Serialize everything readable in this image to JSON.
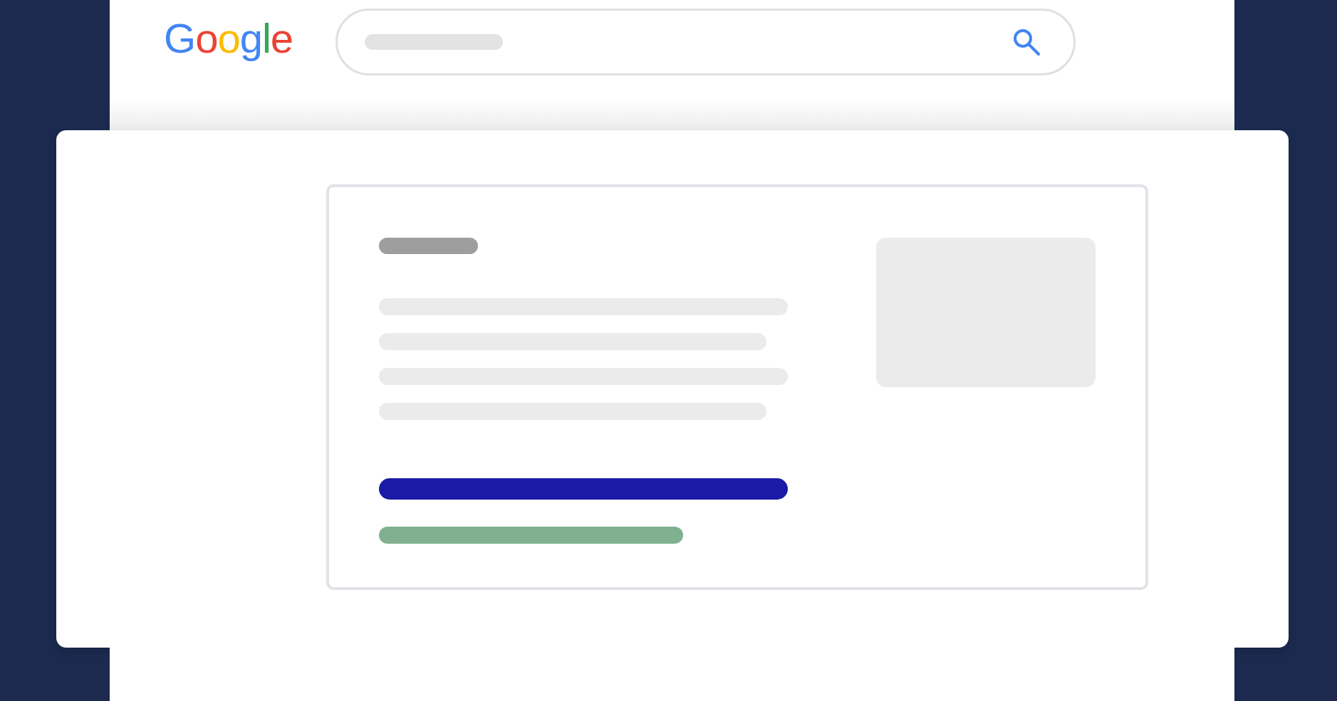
{
  "logo": {
    "text": "Google"
  }
}
